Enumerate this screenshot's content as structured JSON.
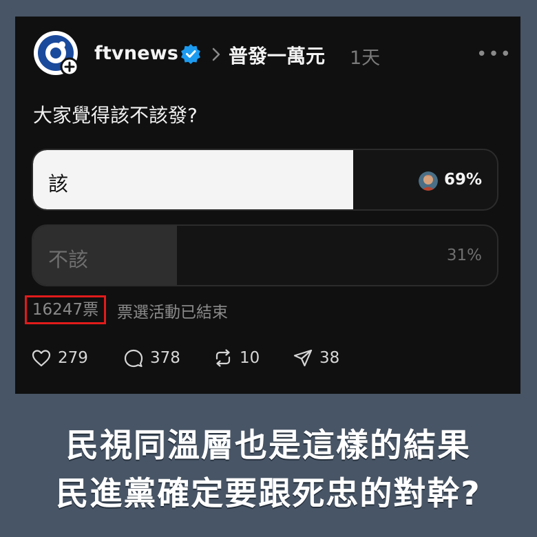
{
  "post": {
    "account": "ftvnews",
    "topic": "普發一萬元",
    "time": "1天",
    "more": "•••",
    "question": "大家覺得該不該發?"
  },
  "poll": {
    "options": [
      {
        "label": "該",
        "percent_text": "69%",
        "percent": 69
      },
      {
        "label": "不該",
        "percent_text": "31%",
        "percent": 31
      }
    ],
    "votes": "16247票",
    "status": "票選活動已結束"
  },
  "actions": {
    "likes": "279",
    "comments": "378",
    "reposts": "10",
    "shares": "38"
  },
  "headline": {
    "line1": "民視同溫層也是這樣的結果",
    "line2": "民進黨確定要跟死忠的對幹?"
  },
  "colors": {
    "background": "#485566",
    "card": "#101010",
    "verified": "#1d9bf0",
    "highlight_box": "#e11b1b",
    "logo_blue": "#1a4a9c"
  }
}
